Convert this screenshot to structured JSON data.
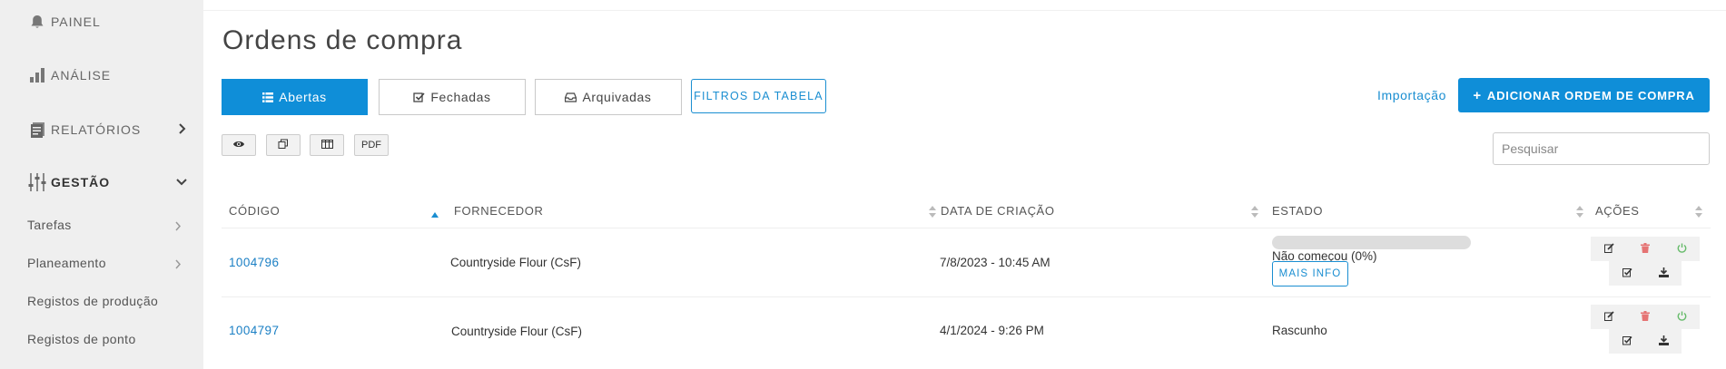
{
  "colors": {
    "accent": "#0f8ed8",
    "link": "#1a7fc4",
    "sidebar_bg": "#efefef",
    "danger": "#e57373",
    "success": "#66bb6a"
  },
  "sidebar": {
    "items": [
      {
        "label": "PAINEL",
        "icon": "bell-icon"
      },
      {
        "label": "ANÁLISE",
        "icon": "bar-chart-icon"
      },
      {
        "label": "RELATÓRIOS",
        "icon": "reports-icon"
      },
      {
        "label": "GESTÃO",
        "icon": "sliders-icon"
      }
    ],
    "subitems": [
      {
        "label": "Tarefas"
      },
      {
        "label": "Planeamento"
      },
      {
        "label": "Registos de produção"
      },
      {
        "label": "Registos de ponto"
      }
    ]
  },
  "page": {
    "title": "Ordens de compra"
  },
  "tabs": [
    {
      "label": "Abertas",
      "icon": "list-icon"
    },
    {
      "label": "Fechadas",
      "icon": "check-square-icon"
    },
    {
      "label": "Arquivadas",
      "icon": "inbox-icon"
    }
  ],
  "filters_label": "FILTROS DA TABELA",
  "import_label": "Importação",
  "add_label": "ADICIONAR ORDEM DE COMPRA",
  "toolbar": {
    "pdf_label": "PDF"
  },
  "search": {
    "placeholder": "Pesquisar"
  },
  "table": {
    "columns": [
      "CÓDIGO",
      "FORNECEDOR",
      "DATA DE CRIAÇÃO",
      "ESTADO",
      "AÇÕES"
    ],
    "rows": [
      {
        "code": "1004796",
        "supplier": "Countryside Flour (CsF)",
        "created": "7/8/2023 - 10:45 AM",
        "status": "Não começou (0%)",
        "progress": 0,
        "more_info": "MAIS INFO"
      },
      {
        "code": "1004797",
        "supplier": "Countryside Flour (CsF)",
        "created": "4/1/2024 - 9:26 PM",
        "status": "Rascunho"
      }
    ]
  }
}
